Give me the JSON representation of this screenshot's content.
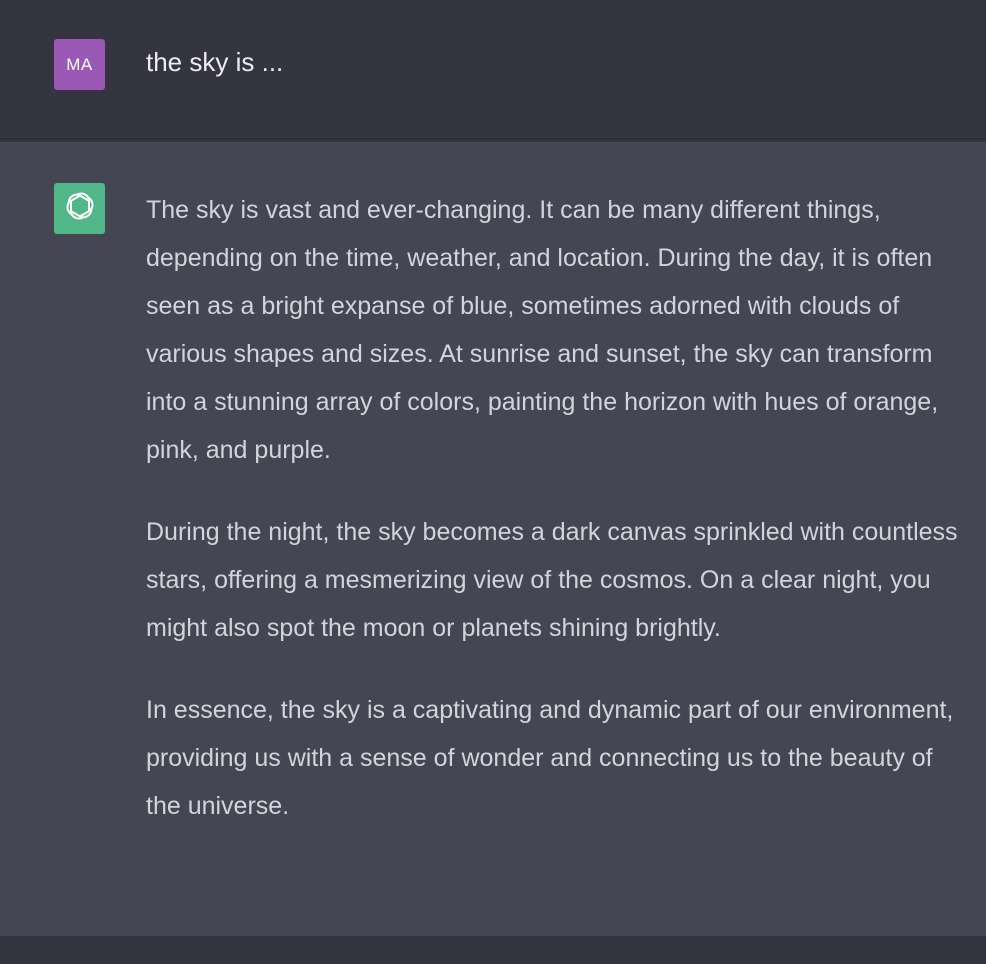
{
  "user": {
    "avatar_initials": "MA",
    "avatar_color": "#9b59b6",
    "message": "the sky is ..."
  },
  "assistant": {
    "avatar_icon": "openai-logo-icon",
    "avatar_color": "#52b788",
    "paragraphs": [
      "The sky is vast and ever-changing. It can be many different things, depending on the time, weather, and location. During the day, it is often seen as a bright expanse of blue, sometimes adorned with clouds of various shapes and sizes. At sunrise and sunset, the sky can transform into a stunning array of colors, painting the horizon with hues of orange, pink, and purple.",
      "During the night, the sky becomes a dark canvas sprinkled with countless stars, offering a mesmerizing view of the cosmos. On a clear night, you might also spot the moon or planets shining brightly.",
      "In essence, the sky is a captivating and dynamic part of our environment, providing us with a sense of wonder and connecting us to the beauty of the universe."
    ]
  },
  "colors": {
    "user_row_bg": "#343541",
    "assistant_row_bg": "#444654",
    "text": "#d1d5db"
  }
}
